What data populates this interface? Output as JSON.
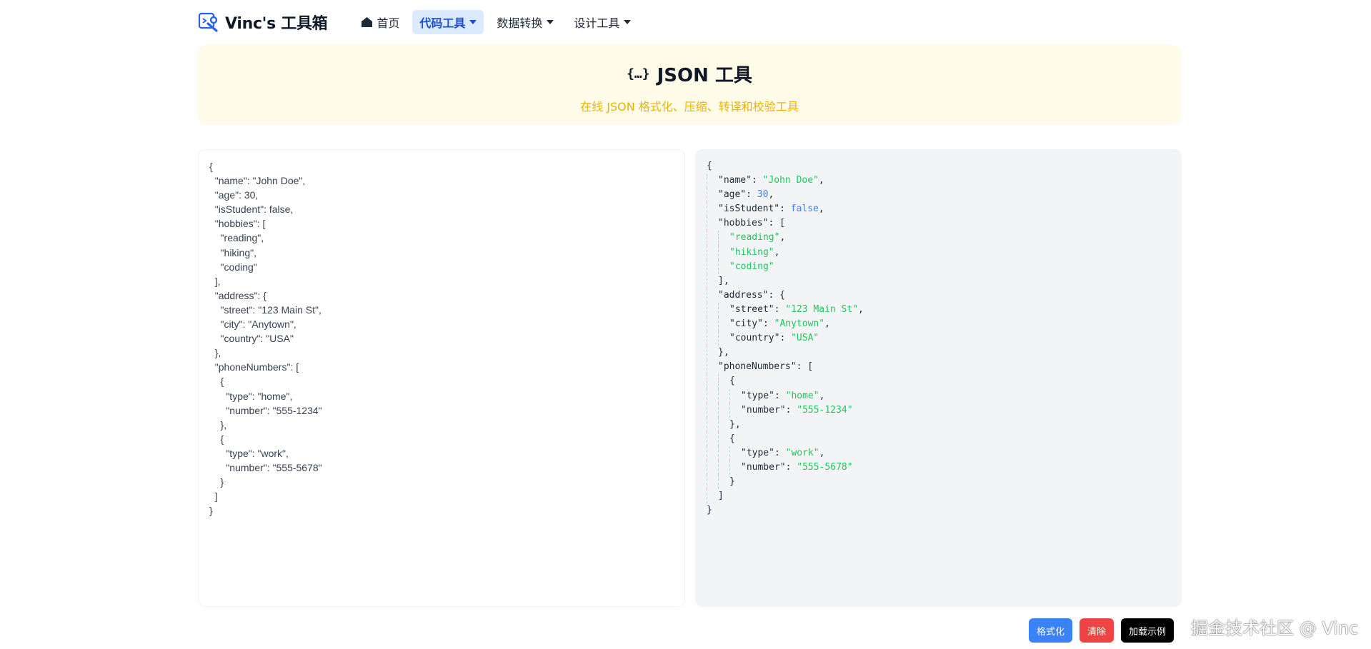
{
  "header": {
    "logo_text": "Vinc's 工具箱",
    "nav": [
      {
        "label": "首页",
        "icon": "home-icon",
        "active": false,
        "dropdown": false
      },
      {
        "label": "代码工具",
        "active": true,
        "dropdown": true
      },
      {
        "label": "数据转换",
        "active": false,
        "dropdown": true
      },
      {
        "label": "设计工具",
        "active": false,
        "dropdown": true
      }
    ]
  },
  "hero": {
    "icon": "{…}",
    "title": "JSON 工具",
    "subtitle": "在线 JSON 格式化、压缩、转译和校验工具"
  },
  "input": {
    "value": "{\n  \"name\": \"John Doe\",\n  \"age\": 30,\n  \"isStudent\": false,\n  \"hobbies\": [\n    \"reading\",\n    \"hiking\",\n    \"coding\"\n  ],\n  \"address\": {\n    \"street\": \"123 Main St\",\n    \"city\": \"Anytown\",\n    \"country\": \"USA\"\n  },\n  \"phoneNumbers\": [\n    {\n      \"type\": \"home\",\n      \"number\": \"555-1234\"\n    },\n    {\n      \"type\": \"work\",\n      \"number\": \"555-5678\"\n    }\n  ]\n}"
  },
  "output": {
    "lines": [
      {
        "indent": 0,
        "tokens": [
          {
            "t": "{",
            "c": "punc"
          }
        ]
      },
      {
        "indent": 1,
        "tokens": [
          {
            "t": "\"name\"",
            "c": "key"
          },
          {
            "t": ": ",
            "c": "punc"
          },
          {
            "t": "\"John Doe\"",
            "c": "str"
          },
          {
            "t": ",",
            "c": "punc"
          }
        ]
      },
      {
        "indent": 1,
        "tokens": [
          {
            "t": "\"age\"",
            "c": "key"
          },
          {
            "t": ": ",
            "c": "punc"
          },
          {
            "t": "30",
            "c": "num"
          },
          {
            "t": ",",
            "c": "punc"
          }
        ]
      },
      {
        "indent": 1,
        "tokens": [
          {
            "t": "\"isStudent\"",
            "c": "key"
          },
          {
            "t": ": ",
            "c": "punc"
          },
          {
            "t": "false",
            "c": "bool"
          },
          {
            "t": ",",
            "c": "punc"
          }
        ]
      },
      {
        "indent": 1,
        "tokens": [
          {
            "t": "\"hobbies\"",
            "c": "key"
          },
          {
            "t": ": [",
            "c": "punc"
          }
        ]
      },
      {
        "indent": 2,
        "tokens": [
          {
            "t": "\"reading\"",
            "c": "str"
          },
          {
            "t": ",",
            "c": "punc"
          }
        ]
      },
      {
        "indent": 2,
        "tokens": [
          {
            "t": "\"hiking\"",
            "c": "str"
          },
          {
            "t": ",",
            "c": "punc"
          }
        ]
      },
      {
        "indent": 2,
        "tokens": [
          {
            "t": "\"coding\"",
            "c": "str"
          }
        ]
      },
      {
        "indent": 1,
        "tokens": [
          {
            "t": "],",
            "c": "punc"
          }
        ]
      },
      {
        "indent": 1,
        "tokens": [
          {
            "t": "\"address\"",
            "c": "key"
          },
          {
            "t": ": {",
            "c": "punc"
          }
        ]
      },
      {
        "indent": 2,
        "tokens": [
          {
            "t": "\"street\"",
            "c": "key"
          },
          {
            "t": ": ",
            "c": "punc"
          },
          {
            "t": "\"123 Main St\"",
            "c": "str"
          },
          {
            "t": ",",
            "c": "punc"
          }
        ]
      },
      {
        "indent": 2,
        "tokens": [
          {
            "t": "\"city\"",
            "c": "key"
          },
          {
            "t": ": ",
            "c": "punc"
          },
          {
            "t": "\"Anytown\"",
            "c": "str"
          },
          {
            "t": ",",
            "c": "punc"
          }
        ]
      },
      {
        "indent": 2,
        "tokens": [
          {
            "t": "\"country\"",
            "c": "key"
          },
          {
            "t": ": ",
            "c": "punc"
          },
          {
            "t": "\"USA\"",
            "c": "str"
          }
        ]
      },
      {
        "indent": 1,
        "tokens": [
          {
            "t": "},",
            "c": "punc"
          }
        ]
      },
      {
        "indent": 1,
        "tokens": [
          {
            "t": "\"phoneNumbers\"",
            "c": "key"
          },
          {
            "t": ": [",
            "c": "punc"
          }
        ]
      },
      {
        "indent": 2,
        "tokens": [
          {
            "t": "{",
            "c": "punc"
          }
        ]
      },
      {
        "indent": 3,
        "tokens": [
          {
            "t": "\"type\"",
            "c": "key"
          },
          {
            "t": ": ",
            "c": "punc"
          },
          {
            "t": "\"home\"",
            "c": "str"
          },
          {
            "t": ",",
            "c": "punc"
          }
        ]
      },
      {
        "indent": 3,
        "tokens": [
          {
            "t": "\"number\"",
            "c": "key"
          },
          {
            "t": ": ",
            "c": "punc"
          },
          {
            "t": "\"555-1234\"",
            "c": "str"
          }
        ]
      },
      {
        "indent": 2,
        "tokens": [
          {
            "t": "},",
            "c": "punc"
          }
        ]
      },
      {
        "indent": 2,
        "tokens": [
          {
            "t": "{",
            "c": "punc"
          }
        ]
      },
      {
        "indent": 3,
        "tokens": [
          {
            "t": "\"type\"",
            "c": "key"
          },
          {
            "t": ": ",
            "c": "punc"
          },
          {
            "t": "\"work\"",
            "c": "str"
          },
          {
            "t": ",",
            "c": "punc"
          }
        ]
      },
      {
        "indent": 3,
        "tokens": [
          {
            "t": "\"number\"",
            "c": "key"
          },
          {
            "t": ": ",
            "c": "punc"
          },
          {
            "t": "\"555-5678\"",
            "c": "str"
          }
        ]
      },
      {
        "indent": 2,
        "tokens": [
          {
            "t": "}",
            "c": "punc"
          }
        ]
      },
      {
        "indent": 1,
        "tokens": [
          {
            "t": "]",
            "c": "punc"
          }
        ]
      },
      {
        "indent": 0,
        "tokens": [
          {
            "t": "}",
            "c": "punc"
          }
        ]
      }
    ]
  },
  "actions": {
    "format_label": "格式化",
    "clear_label": "清除",
    "load_example_label": "加载示例"
  },
  "watermark": "掘金技术社区 @ Vinc",
  "colors": {
    "accent": "#3b82f6",
    "danger": "#ef4444",
    "hero_bg": "#fefce8",
    "hero_subtitle": "#eab308",
    "json_string": "#22c55e",
    "json_number": "#3b82f6"
  }
}
